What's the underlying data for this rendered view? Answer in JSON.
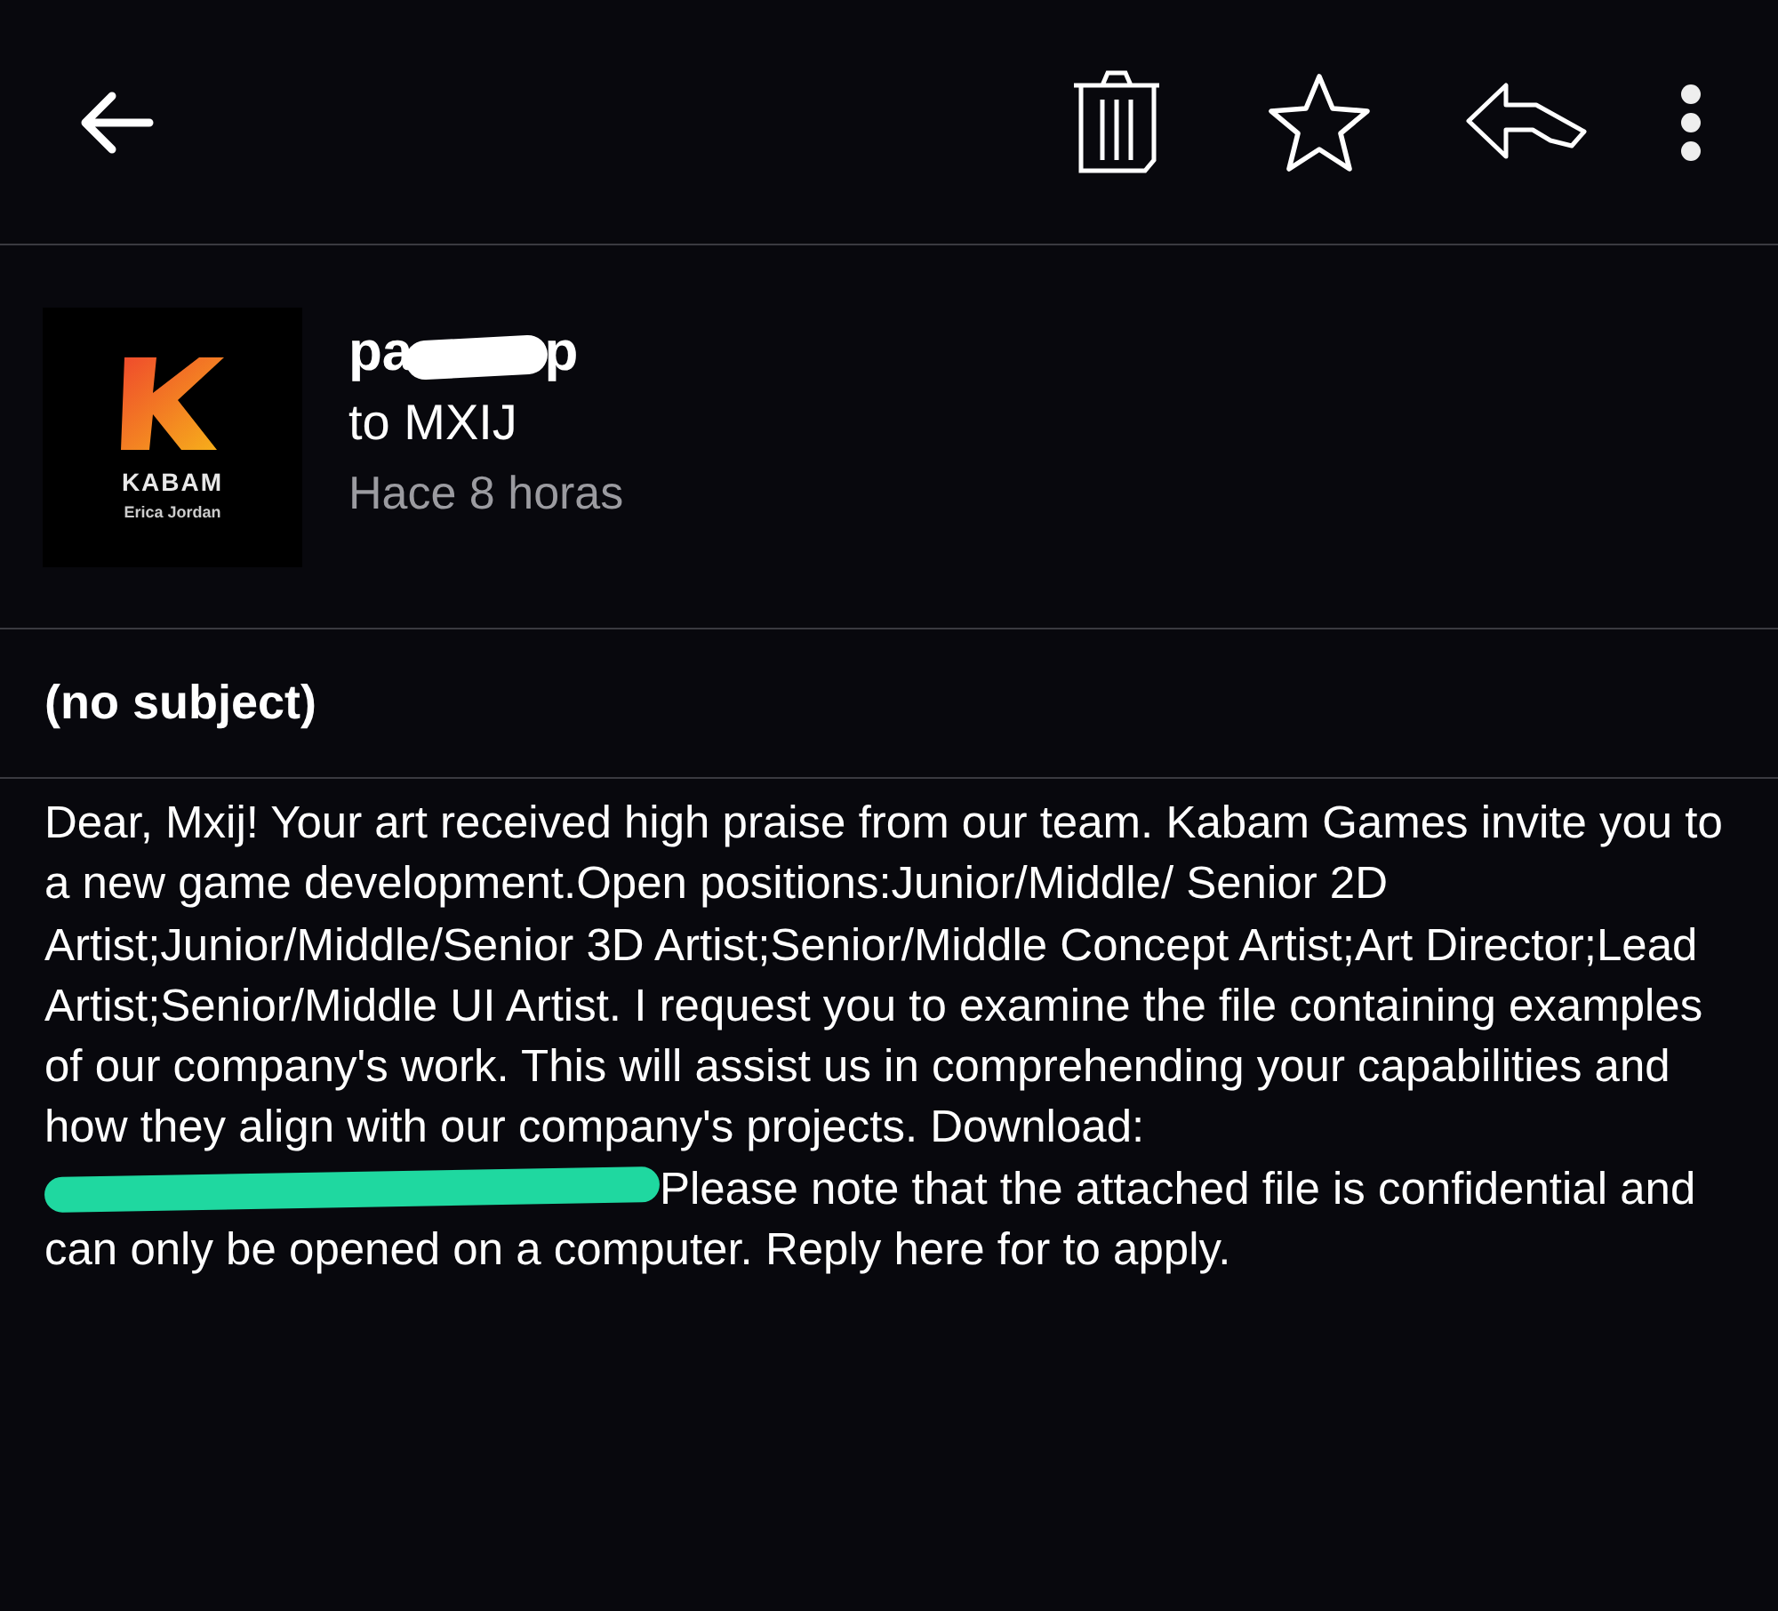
{
  "toolbar": {
    "actions": [
      {
        "kind": "back"
      },
      {
        "kind": "delete"
      },
      {
        "kind": "star",
        "on": false
      },
      {
        "kind": "reply"
      },
      {
        "kind": "more"
      }
    ]
  },
  "message": {
    "avatar": {
      "brand": "KABAM",
      "caption": "Erica Jordan"
    },
    "sender": {
      "parts": [
        "pa",
        "p"
      ],
      "redacted": true
    },
    "recipient": "to MXIJ",
    "time": "Hace 8 horas",
    "subject": "(no subject)",
    "body": {
      "parts": [
        "Dear, Mxij! Your art received high praise from our team. Kabam Games invite you to a new game development.Open positions:Junior/Middle/ Senior 2D Artist;Junior/Middle/Senior 3D Artist;Senior/Middle Concept Artist;Art Director;Lead Artist;Senior/Middle UI Artist. I request you to examine the file containing examples of our company's work. This will assist us in comprehending your capabilities and how they align with our company's projects. Download:",
        "Please note that the attached file is confidential and can only be opened on a computer. Reply here for to apply."
      ],
      "link_redacted": true
    }
  }
}
